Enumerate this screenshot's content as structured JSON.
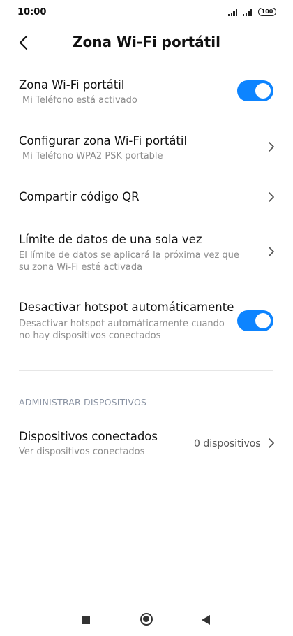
{
  "status_bar": {
    "time": "10:00",
    "battery": "100"
  },
  "header": {
    "title": "Zona Wi-Fi portátil"
  },
  "settings": [
    {
      "title": "Zona Wi-Fi portátil",
      "subtitle": "Mi Teléfono está activado",
      "control": "toggle",
      "enabled": true
    },
    {
      "title": "Configurar zona Wi-Fi portátil",
      "subtitle": "Mi Teléfono WPA2 PSK portable",
      "control": "chevron"
    },
    {
      "title": "Compartir código QR",
      "control": "chevron"
    },
    {
      "title": "Límite de datos de una sola vez",
      "subtitle_line1": "El límite de datos se aplicará la próxima vez que",
      "subtitle_line2": "su zona Wi-Fi esté activada",
      "control": "chevron"
    },
    {
      "title": "Desactivar hotspot automáticamente",
      "subtitle_line1": "Desactivar hotspot automáticamente cuando",
      "subtitle_line2": "no hay dispositivos conectados",
      "control": "toggle",
      "enabled": true
    }
  ],
  "devices_section": {
    "header": "ADMINISTRAR DISPOSITIVOS",
    "row": {
      "title": "Dispositivos conectados",
      "subtitle": "Ver dispositivos conectados",
      "value": "0 dispositivos",
      "control": "chevron"
    }
  },
  "colors": {
    "accent": "#0d84ff",
    "subtitle": "#8c8c8c",
    "section_header": "#8a93a3"
  },
  "icons": {
    "back": "chevron-left-icon",
    "row_arrow": "chevron-right-icon",
    "nav_recent": "square-icon",
    "nav_home": "circle-icon",
    "nav_back": "triangle-icon"
  }
}
